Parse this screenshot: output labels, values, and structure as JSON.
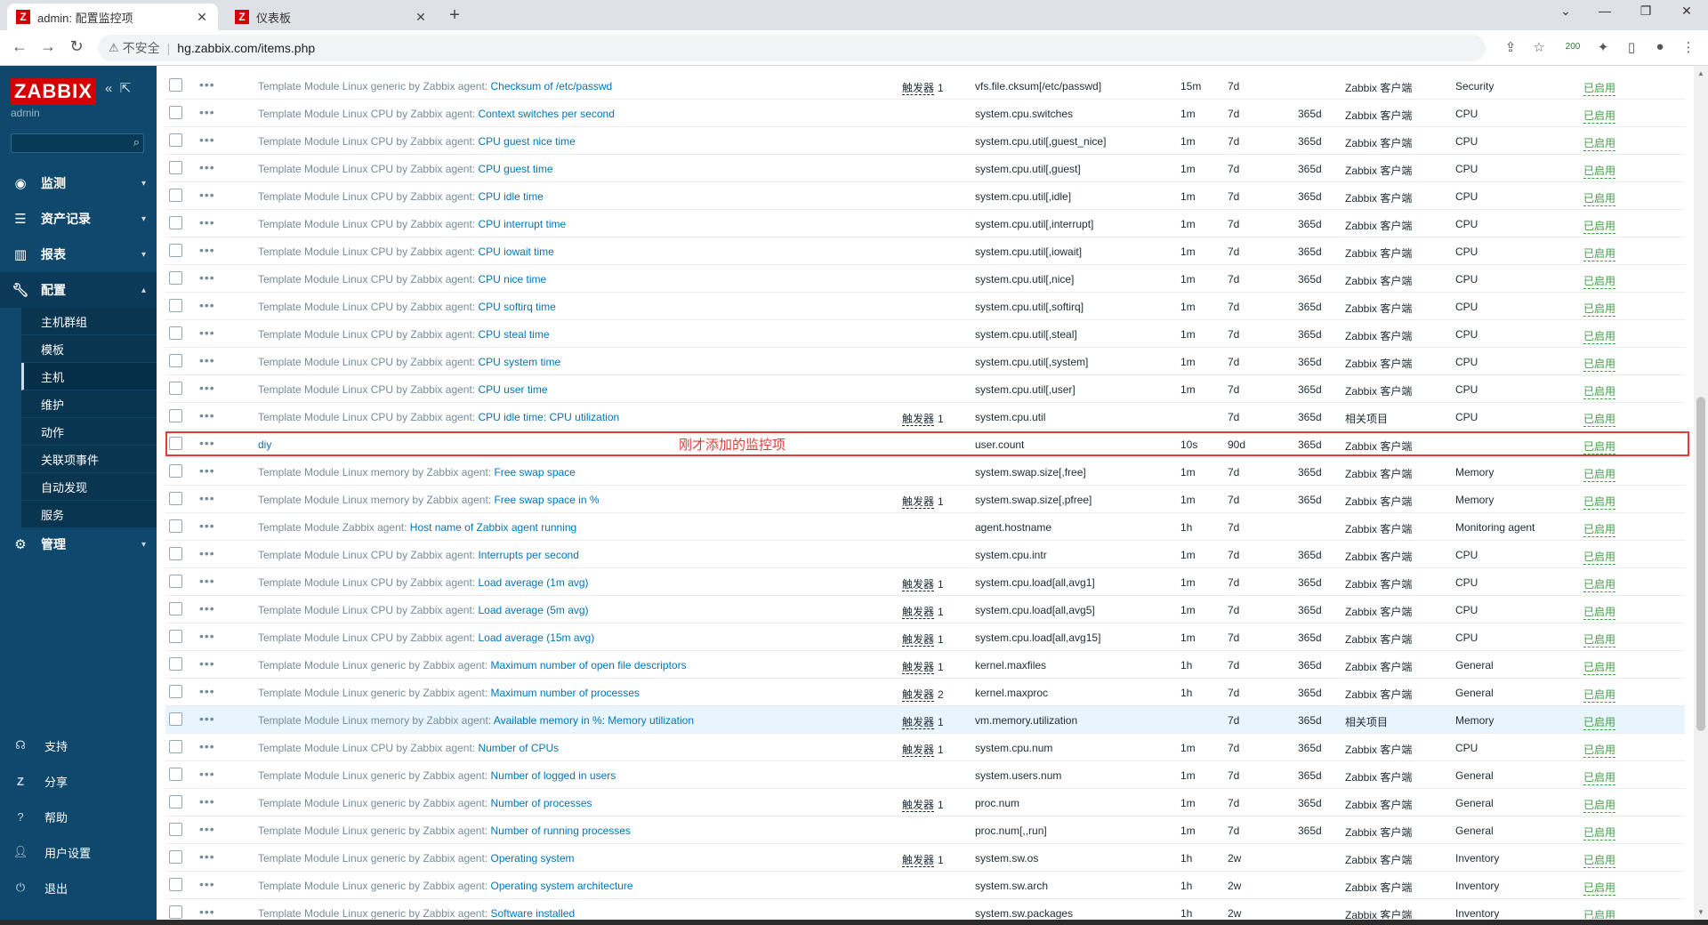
{
  "browser": {
    "tabs": [
      {
        "title": "admin: 配置监控项",
        "icon": "zabbix-logo"
      },
      {
        "title": "仪表板",
        "icon": "zabbix-logo"
      }
    ],
    "new_tab": "+",
    "not_secure": "不安全",
    "url": "hg.zabbix.com/items.php",
    "badge": "200"
  },
  "sidebar": {
    "logo": "ZABBIX",
    "user": "admin",
    "menu": [
      {
        "label": "监测",
        "icon": "eye-icon"
      },
      {
        "label": "资产记录",
        "icon": "list-icon"
      },
      {
        "label": "报表",
        "icon": "chart-icon"
      },
      {
        "label": "配置",
        "icon": "wrench-icon"
      },
      {
        "label": "管理",
        "icon": "gear-icon"
      }
    ],
    "submenu": [
      "主机群组",
      "模板",
      "主机",
      "维护",
      "动作",
      "关联项事件",
      "自动发现",
      "服务"
    ],
    "active_submenu": "主机",
    "bottom": [
      {
        "label": "支持",
        "icon": "headset-icon"
      },
      {
        "label": "分享",
        "icon": "share-icon"
      },
      {
        "label": "帮助",
        "icon": "help-icon"
      },
      {
        "label": "用户设置",
        "icon": "user-icon"
      },
      {
        "label": "退出",
        "icon": "power-icon"
      }
    ]
  },
  "annotation": "刚才添加的监控项",
  "status_label": "已启用",
  "trigger_label": "触发器",
  "rows": [
    {
      "tpl": "Template Module Linux generic by Zabbix agent",
      "item": "Checksum of /etc/passwd",
      "trig": "1",
      "key": "vfs.file.cksum[/etc/passwd]",
      "interval": "15m",
      "history": "7d",
      "trends": "",
      "type": "Zabbix 客户端",
      "app": "Security"
    },
    {
      "tpl": "Template Module Linux CPU by Zabbix agent",
      "item": "Context switches per second",
      "trig": "",
      "key": "system.cpu.switches",
      "interval": "1m",
      "history": "7d",
      "trends": "365d",
      "type": "Zabbix 客户端",
      "app": "CPU"
    },
    {
      "tpl": "Template Module Linux CPU by Zabbix agent",
      "item": "CPU guest nice time",
      "trig": "",
      "key": "system.cpu.util[,guest_nice]",
      "interval": "1m",
      "history": "7d",
      "trends": "365d",
      "type": "Zabbix 客户端",
      "app": "CPU"
    },
    {
      "tpl": "Template Module Linux CPU by Zabbix agent",
      "item": "CPU guest time",
      "trig": "",
      "key": "system.cpu.util[,guest]",
      "interval": "1m",
      "history": "7d",
      "trends": "365d",
      "type": "Zabbix 客户端",
      "app": "CPU"
    },
    {
      "tpl": "Template Module Linux CPU by Zabbix agent",
      "item": "CPU idle time",
      "trig": "",
      "key": "system.cpu.util[,idle]",
      "interval": "1m",
      "history": "7d",
      "trends": "365d",
      "type": "Zabbix 客户端",
      "app": "CPU"
    },
    {
      "tpl": "Template Module Linux CPU by Zabbix agent",
      "item": "CPU interrupt time",
      "trig": "",
      "key": "system.cpu.util[,interrupt]",
      "interval": "1m",
      "history": "7d",
      "trends": "365d",
      "type": "Zabbix 客户端",
      "app": "CPU"
    },
    {
      "tpl": "Template Module Linux CPU by Zabbix agent",
      "item": "CPU iowait time",
      "trig": "",
      "key": "system.cpu.util[,iowait]",
      "interval": "1m",
      "history": "7d",
      "trends": "365d",
      "type": "Zabbix 客户端",
      "app": "CPU"
    },
    {
      "tpl": "Template Module Linux CPU by Zabbix agent",
      "item": "CPU nice time",
      "trig": "",
      "key": "system.cpu.util[,nice]",
      "interval": "1m",
      "history": "7d",
      "trends": "365d",
      "type": "Zabbix 客户端",
      "app": "CPU"
    },
    {
      "tpl": "Template Module Linux CPU by Zabbix agent",
      "item": "CPU softirq time",
      "trig": "",
      "key": "system.cpu.util[,softirq]",
      "interval": "1m",
      "history": "7d",
      "trends": "365d",
      "type": "Zabbix 客户端",
      "app": "CPU"
    },
    {
      "tpl": "Template Module Linux CPU by Zabbix agent",
      "item": "CPU steal time",
      "trig": "",
      "key": "system.cpu.util[,steal]",
      "interval": "1m",
      "history": "7d",
      "trends": "365d",
      "type": "Zabbix 客户端",
      "app": "CPU"
    },
    {
      "tpl": "Template Module Linux CPU by Zabbix agent",
      "item": "CPU system time",
      "trig": "",
      "key": "system.cpu.util[,system]",
      "interval": "1m",
      "history": "7d",
      "trends": "365d",
      "type": "Zabbix 客户端",
      "app": "CPU"
    },
    {
      "tpl": "Template Module Linux CPU by Zabbix agent",
      "item": "CPU user time",
      "trig": "",
      "key": "system.cpu.util[,user]",
      "interval": "1m",
      "history": "7d",
      "trends": "365d",
      "type": "Zabbix 客户端",
      "app": "CPU"
    },
    {
      "tpl": "Template Module Linux CPU by Zabbix agent",
      "item": "CPU idle time: CPU utilization",
      "trig": "1",
      "key": "system.cpu.util",
      "interval": "",
      "history": "7d",
      "trends": "365d",
      "type": "相关项目",
      "app": "CPU"
    },
    {
      "tpl": "",
      "item": "diy",
      "trig": "",
      "key": "user.count",
      "interval": "10s",
      "history": "90d",
      "trends": "365d",
      "type": "Zabbix 客户端",
      "app": ""
    },
    {
      "tpl": "Template Module Linux memory by Zabbix agent",
      "item": "Free swap space",
      "trig": "",
      "key": "system.swap.size[,free]",
      "interval": "1m",
      "history": "7d",
      "trends": "365d",
      "type": "Zabbix 客户端",
      "app": "Memory"
    },
    {
      "tpl": "Template Module Linux memory by Zabbix agent",
      "item": "Free swap space in %",
      "trig": "1",
      "key": "system.swap.size[,pfree]",
      "interval": "1m",
      "history": "7d",
      "trends": "365d",
      "type": "Zabbix 客户端",
      "app": "Memory"
    },
    {
      "tpl": "Template Module Zabbix agent",
      "item": "Host name of Zabbix agent running",
      "trig": "",
      "key": "agent.hostname",
      "interval": "1h",
      "history": "7d",
      "trends": "",
      "type": "Zabbix 客户端",
      "app": "Monitoring agent"
    },
    {
      "tpl": "Template Module Linux CPU by Zabbix agent",
      "item": "Interrupts per second",
      "trig": "",
      "key": "system.cpu.intr",
      "interval": "1m",
      "history": "7d",
      "trends": "365d",
      "type": "Zabbix 客户端",
      "app": "CPU"
    },
    {
      "tpl": "Template Module Linux CPU by Zabbix agent",
      "item": "Load average (1m avg)",
      "trig": "1",
      "key": "system.cpu.load[all,avg1]",
      "interval": "1m",
      "history": "7d",
      "trends": "365d",
      "type": "Zabbix 客户端",
      "app": "CPU"
    },
    {
      "tpl": "Template Module Linux CPU by Zabbix agent",
      "item": "Load average (5m avg)",
      "trig": "1",
      "key": "system.cpu.load[all,avg5]",
      "interval": "1m",
      "history": "7d",
      "trends": "365d",
      "type": "Zabbix 客户端",
      "app": "CPU"
    },
    {
      "tpl": "Template Module Linux CPU by Zabbix agent",
      "item": "Load average (15m avg)",
      "trig": "1",
      "key": "system.cpu.load[all,avg15]",
      "interval": "1m",
      "history": "7d",
      "trends": "365d",
      "type": "Zabbix 客户端",
      "app": "CPU"
    },
    {
      "tpl": "Template Module Linux generic by Zabbix agent",
      "item": "Maximum number of open file descriptors",
      "trig": "1",
      "key": "kernel.maxfiles",
      "interval": "1h",
      "history": "7d",
      "trends": "365d",
      "type": "Zabbix 客户端",
      "app": "General"
    },
    {
      "tpl": "Template Module Linux generic by Zabbix agent",
      "item": "Maximum number of processes",
      "trig": "2",
      "key": "kernel.maxproc",
      "interval": "1h",
      "history": "7d",
      "trends": "365d",
      "type": "Zabbix 客户端",
      "app": "General"
    },
    {
      "tpl": "Template Module Linux memory by Zabbix agent",
      "item": "Available memory in %: Memory utilization",
      "trig": "1",
      "key": "vm.memory.utilization",
      "interval": "",
      "history": "7d",
      "trends": "365d",
      "type": "相关项目",
      "app": "Memory"
    },
    {
      "tpl": "Template Module Linux CPU by Zabbix agent",
      "item": "Number of CPUs",
      "trig": "1",
      "key": "system.cpu.num",
      "interval": "1m",
      "history": "7d",
      "trends": "365d",
      "type": "Zabbix 客户端",
      "app": "CPU"
    },
    {
      "tpl": "Template Module Linux generic by Zabbix agent",
      "item": "Number of logged in users",
      "trig": "",
      "key": "system.users.num",
      "interval": "1m",
      "history": "7d",
      "trends": "365d",
      "type": "Zabbix 客户端",
      "app": "General"
    },
    {
      "tpl": "Template Module Linux generic by Zabbix agent",
      "item": "Number of processes",
      "trig": "1",
      "key": "proc.num",
      "interval": "1m",
      "history": "7d",
      "trends": "365d",
      "type": "Zabbix 客户端",
      "app": "General"
    },
    {
      "tpl": "Template Module Linux generic by Zabbix agent",
      "item": "Number of running processes",
      "trig": "",
      "key": "proc.num[,,run]",
      "interval": "1m",
      "history": "7d",
      "trends": "365d",
      "type": "Zabbix 客户端",
      "app": "General"
    },
    {
      "tpl": "Template Module Linux generic by Zabbix agent",
      "item": "Operating system",
      "trig": "1",
      "key": "system.sw.os",
      "interval": "1h",
      "history": "2w",
      "trends": "",
      "type": "Zabbix 客户端",
      "app": "Inventory"
    },
    {
      "tpl": "Template Module Linux generic by Zabbix agent",
      "item": "Operating system architecture",
      "trig": "",
      "key": "system.sw.arch",
      "interval": "1h",
      "history": "2w",
      "trends": "",
      "type": "Zabbix 客户端",
      "app": "Inventory"
    },
    {
      "tpl": "Template Module Linux generic by Zabbix agent",
      "item": "Software installed",
      "trig": "",
      "key": "system.sw.packages",
      "interval": "1h",
      "history": "2w",
      "trends": "",
      "type": "Zabbix 客户端",
      "app": "Inventory"
    }
  ],
  "highlighted_row": 23
}
